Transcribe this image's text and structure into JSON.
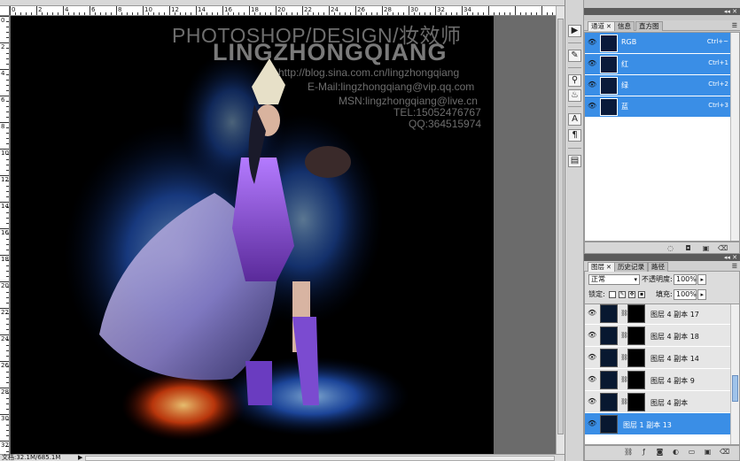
{
  "canvas": {
    "watermark": {
      "title": "PHOTOSHOP/DESIGN/妆效师",
      "name": "LINGZHONGQIANG",
      "blog": "http://blog.sina.com.cn/lingzhongqiang",
      "email": "E-Mail:lingzhongqiang@vip.qq.com",
      "msn": "MSN:lingzhongqiang@live.cn",
      "tel": "TEL:15052476767",
      "qq": "QQ:364515974"
    }
  },
  "rulers": {
    "top_numbers": [
      "0",
      "2",
      "4",
      "6",
      "8",
      "10",
      "12",
      "14",
      "16",
      "18",
      "20",
      "22",
      "24",
      "26",
      "28",
      "30",
      "32",
      "34"
    ],
    "left_numbers": [
      "0",
      "2",
      "4",
      "6",
      "8",
      "10",
      "12",
      "14",
      "16",
      "18",
      "20",
      "22",
      "24",
      "26",
      "28",
      "30",
      "32",
      "34"
    ]
  },
  "status": {
    "doc_size": "文档:32.1M/685.1M",
    "arrow": "▶"
  },
  "tools": [
    {
      "icon": "play-icon",
      "glyph": "▶"
    },
    {
      "icon": "brush-tool-icon",
      "glyph": "✎"
    },
    {
      "icon": "clone-stamp-icon",
      "glyph": "⚲"
    },
    {
      "icon": "history-brush-icon",
      "glyph": "♨"
    },
    {
      "icon": "type-tool-icon",
      "glyph": "A"
    },
    {
      "icon": "paragraph-icon",
      "glyph": "¶"
    },
    {
      "icon": "notes-icon",
      "glyph": "▤"
    }
  ],
  "channels_panel": {
    "tabs": [
      {
        "label": "通道",
        "active": true,
        "closable": true
      },
      {
        "label": "信息",
        "active": false,
        "closable": false
      },
      {
        "label": "直方图",
        "active": false,
        "closable": false
      }
    ],
    "rows": [
      {
        "name": "RGB",
        "shortcut": "Ctrl+~"
      },
      {
        "name": "红",
        "shortcut": "Ctrl+1"
      },
      {
        "name": "绿",
        "shortcut": "Ctrl+2"
      },
      {
        "name": "蓝",
        "shortcut": "Ctrl+3"
      }
    ]
  },
  "layers_panel": {
    "tabs": [
      {
        "label": "图层",
        "active": true,
        "closable": true
      },
      {
        "label": "历史记录",
        "active": false,
        "closable": false
      },
      {
        "label": "路径",
        "active": false,
        "closable": false
      }
    ],
    "blend_mode": "正常",
    "opacity_label": "不透明度:",
    "opacity_value": "100%",
    "lock_label": "锁定:",
    "fill_label": "填充:",
    "fill_value": "100%",
    "layers": [
      {
        "name": "图层 4 副本 17",
        "selected": false,
        "has_mask": true
      },
      {
        "name": "图层 4 副本 18",
        "selected": false,
        "has_mask": true
      },
      {
        "name": "图层 4 副本 14",
        "selected": false,
        "has_mask": true
      },
      {
        "name": "图层 4 副本 9",
        "selected": false,
        "has_mask": true
      },
      {
        "name": "图层 4 副本",
        "selected": false,
        "has_mask": true
      },
      {
        "name": "图层 1 副本 13",
        "selected": true,
        "has_mask": false
      }
    ]
  },
  "colors": {
    "selection": "#3a8ee6",
    "canvas_bg": "#000000",
    "workspace_bg": "#6b6b6b"
  }
}
